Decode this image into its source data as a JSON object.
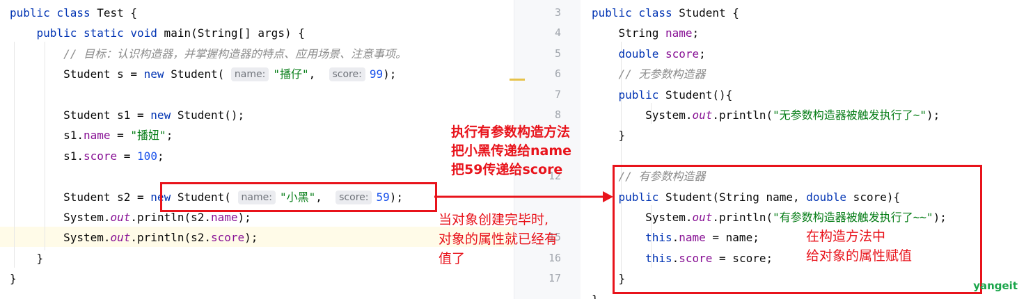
{
  "left_editor": {
    "lines": [
      [
        {
          "t": "public class Test {",
          "c": "kw2"
        }
      ],
      [
        {
          "t": "    "
        },
        {
          "t": "public static void",
          "c": "kw"
        },
        {
          "t": " main(String[] args) {"
        }
      ],
      [
        {
          "t": "        "
        },
        {
          "t": "// 目标：认识构造器，并掌握构造器的特点、应用场景、注意事项。",
          "c": "cmt"
        }
      ],
      [
        {
          "t": "        Student s = "
        },
        {
          "t": "new",
          "c": "kw"
        },
        {
          "t": " Student( "
        },
        {
          "h": "name:"
        },
        {
          "t": "\"播仔\"",
          "c": "str"
        },
        {
          "t": ",  "
        },
        {
          "h": "score:"
        },
        {
          "t": "99",
          "c": "num"
        },
        {
          "t": ");"
        }
      ],
      [],
      [
        {
          "t": "        Student s1 = "
        },
        {
          "t": "new",
          "c": "kw"
        },
        {
          "t": " Student();"
        }
      ],
      [
        {
          "t": "        s1."
        },
        {
          "t": "name",
          "c": "fld"
        },
        {
          "t": " = "
        },
        {
          "t": "\"播妞\"",
          "c": "str"
        },
        {
          "t": ";"
        }
      ],
      [
        {
          "t": "        s1."
        },
        {
          "t": "score",
          "c": "fld"
        },
        {
          "t": " = "
        },
        {
          "t": "100",
          "c": "num"
        },
        {
          "t": ";"
        }
      ],
      [],
      [
        {
          "t": "        Student s2 = "
        },
        {
          "t": "new",
          "c": "kw"
        },
        {
          "t": " Student( "
        },
        {
          "h": "name:"
        },
        {
          "t": "\"小黑\"",
          "c": "str"
        },
        {
          "t": ",  "
        },
        {
          "h": "score:"
        },
        {
          "t": "59",
          "c": "num"
        },
        {
          "t": ");"
        }
      ],
      [
        {
          "t": "        System."
        },
        {
          "t": "out",
          "c": "sta"
        },
        {
          "t": ".println(s2."
        },
        {
          "t": "name",
          "c": "fld"
        },
        {
          "t": ");"
        }
      ],
      [
        {
          "t": "        System."
        },
        {
          "t": "out",
          "c": "sta"
        },
        {
          "t": ".println(s2."
        },
        {
          "t": "score",
          "c": "fld"
        },
        {
          "t": ");"
        }
      ],
      [
        {
          "t": "    }"
        }
      ],
      [
        {
          "t": "}"
        }
      ]
    ]
  },
  "right_editor": {
    "line_numbers": [
      "3",
      "4",
      "5",
      "6",
      "7",
      "8",
      "",
      "",
      "12",
      "",
      "",
      "15",
      "16",
      "17"
    ],
    "lines": [
      [
        {
          "t": "public class",
          "c": "kw"
        },
        {
          "t": " Student {"
        }
      ],
      [
        {
          "t": "    String "
        },
        {
          "t": "name",
          "c": "fld"
        },
        {
          "t": ";"
        }
      ],
      [
        {
          "t": "    "
        },
        {
          "t": "double",
          "c": "kw"
        },
        {
          "t": " "
        },
        {
          "t": "score",
          "c": "fld"
        },
        {
          "t": ";"
        }
      ],
      [
        {
          "t": "    "
        },
        {
          "t": "// 无参数构造器",
          "c": "cmt"
        }
      ],
      [
        {
          "t": "    "
        },
        {
          "t": "public",
          "c": "kw"
        },
        {
          "t": " Student(){"
        }
      ],
      [
        {
          "t": "        System."
        },
        {
          "t": "out",
          "c": "sta"
        },
        {
          "t": ".println("
        },
        {
          "t": "\"无参数构造器被触发执行了~\"",
          "c": "str"
        },
        {
          "t": ");"
        }
      ],
      [
        {
          "t": "    }"
        }
      ],
      [],
      [
        {
          "t": "    "
        },
        {
          "t": "// 有参数构造器",
          "c": "cmt"
        }
      ],
      [
        {
          "t": "    "
        },
        {
          "t": "public",
          "c": "kw"
        },
        {
          "t": " Student(String name, "
        },
        {
          "t": "double",
          "c": "kw"
        },
        {
          "t": " score){"
        }
      ],
      [
        {
          "t": "        System."
        },
        {
          "t": "out",
          "c": "sta"
        },
        {
          "t": ".println("
        },
        {
          "t": "\"有参数构造器被触发执行了~~\"",
          "c": "str"
        },
        {
          "t": ");"
        }
      ],
      [
        {
          "t": "        "
        },
        {
          "t": "this",
          "c": "kw"
        },
        {
          "t": "."
        },
        {
          "t": "name",
          "c": "fld"
        },
        {
          "t": " = name;"
        }
      ],
      [
        {
          "t": "        "
        },
        {
          "t": "this",
          "c": "kw"
        },
        {
          "t": "."
        },
        {
          "t": "score",
          "c": "fld"
        },
        {
          "t": " = score;"
        }
      ],
      [
        {
          "t": "    }"
        }
      ],
      [
        {
          "t": "}"
        }
      ]
    ]
  },
  "annotations": {
    "call_note_line1": "执行有参数构造方法",
    "call_note_line2": "把小黑传递给name",
    "call_note_line3": "把59传递给score",
    "result_note_line1": "当对象创建完毕时,",
    "result_note_line2": "对象的属性就已经有",
    "result_note_line3": "值了",
    "ctor_note_line1": "在构造方法中",
    "ctor_note_line2": "给对象的属性赋值"
  },
  "watermark": "yangeit",
  "colors": {
    "keyword": "#0033b3",
    "field": "#871094",
    "string": "#067d17",
    "number": "#1750eb",
    "comment": "#8c8c8c",
    "annotation": "#e8131b",
    "watermark": "#1aa54a"
  }
}
